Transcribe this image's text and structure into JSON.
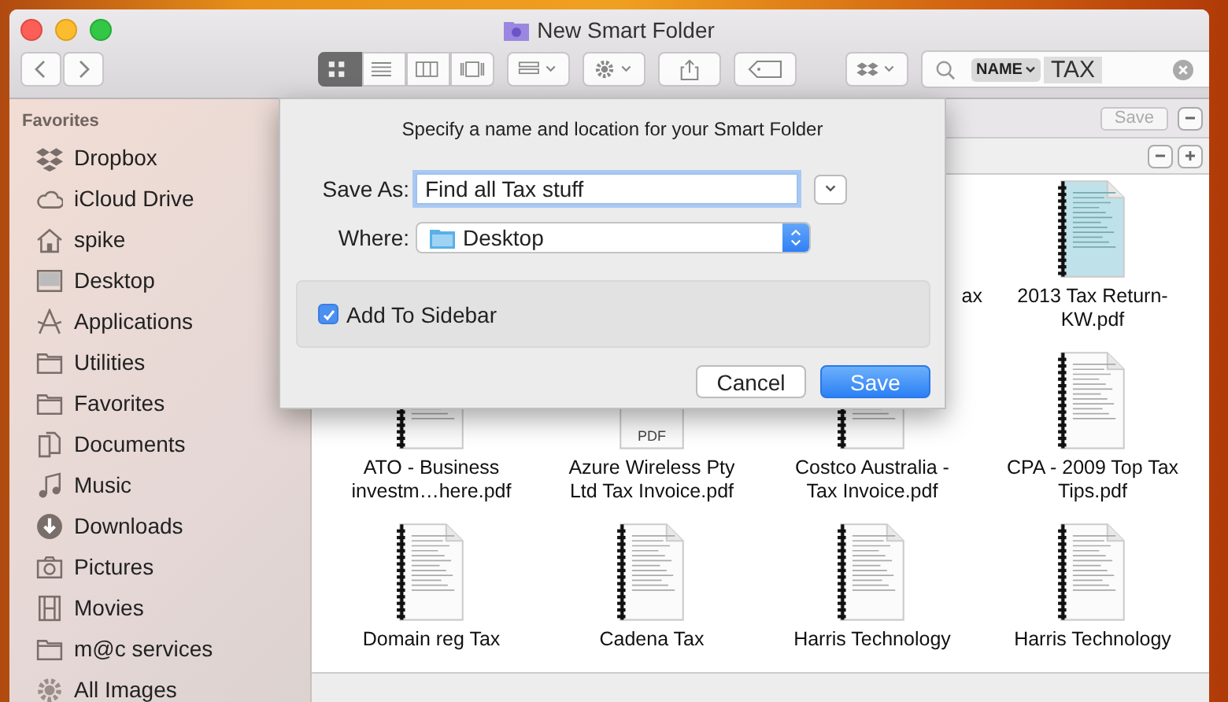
{
  "window": {
    "title": "New Smart Folder"
  },
  "toolbar": {
    "views": [
      {
        "selected": true
      },
      {
        "selected": false
      },
      {
        "selected": false
      },
      {
        "selected": false
      }
    ],
    "search": {
      "token": "NAME",
      "value": "TAX"
    }
  },
  "sidebar": {
    "heading": "Favorites",
    "items": [
      {
        "label": "Dropbox"
      },
      {
        "label": "iCloud Drive"
      },
      {
        "label": "spike"
      },
      {
        "label": "Desktop"
      },
      {
        "label": "Applications"
      },
      {
        "label": "Utilities"
      },
      {
        "label": "Favorites"
      },
      {
        "label": "Documents"
      },
      {
        "label": "Music"
      },
      {
        "label": "Downloads"
      },
      {
        "label": "Pictures"
      },
      {
        "label": "Movies"
      },
      {
        "label": "m@c services"
      },
      {
        "label": "All Images"
      }
    ]
  },
  "search_bar": {
    "save_button": {
      "label": "Save",
      "disabled": true
    }
  },
  "covered_file_label": "ax",
  "files": [
    {
      "kind": "form",
      "label": "2013 Tax Return-KW.pdf"
    },
    {
      "kind": "binder",
      "label": "ATO - Business investm…here.pdf"
    },
    {
      "kind": "pdf",
      "badge": "PDF",
      "label": "Azure Wireless Pty Ltd Tax Invoice.pdf"
    },
    {
      "kind": "binder",
      "label": "Costco Australia - Tax Invoice.pdf"
    },
    {
      "kind": "binder",
      "label": "CPA - 2009 Top Tax Tips.pdf"
    },
    {
      "kind": "binder",
      "label": "Domain reg Tax"
    },
    {
      "kind": "binder",
      "label": "Cadena Tax"
    },
    {
      "kind": "binder",
      "label": "Harris Technology"
    },
    {
      "kind": "binder",
      "label": "Harris Technology"
    }
  ],
  "dialog": {
    "message": "Specify a name and location for your Smart Folder",
    "save_as_label": "Save As:",
    "save_as_value": "Find all Tax stuff",
    "where_label": "Where:",
    "where_value": "Desktop",
    "add_to_sidebar": {
      "label": "Add To Sidebar",
      "checked": true
    },
    "buttons": [
      {
        "label": "Cancel",
        "kind": "cancel"
      },
      {
        "label": "Save",
        "kind": "default"
      }
    ]
  }
}
